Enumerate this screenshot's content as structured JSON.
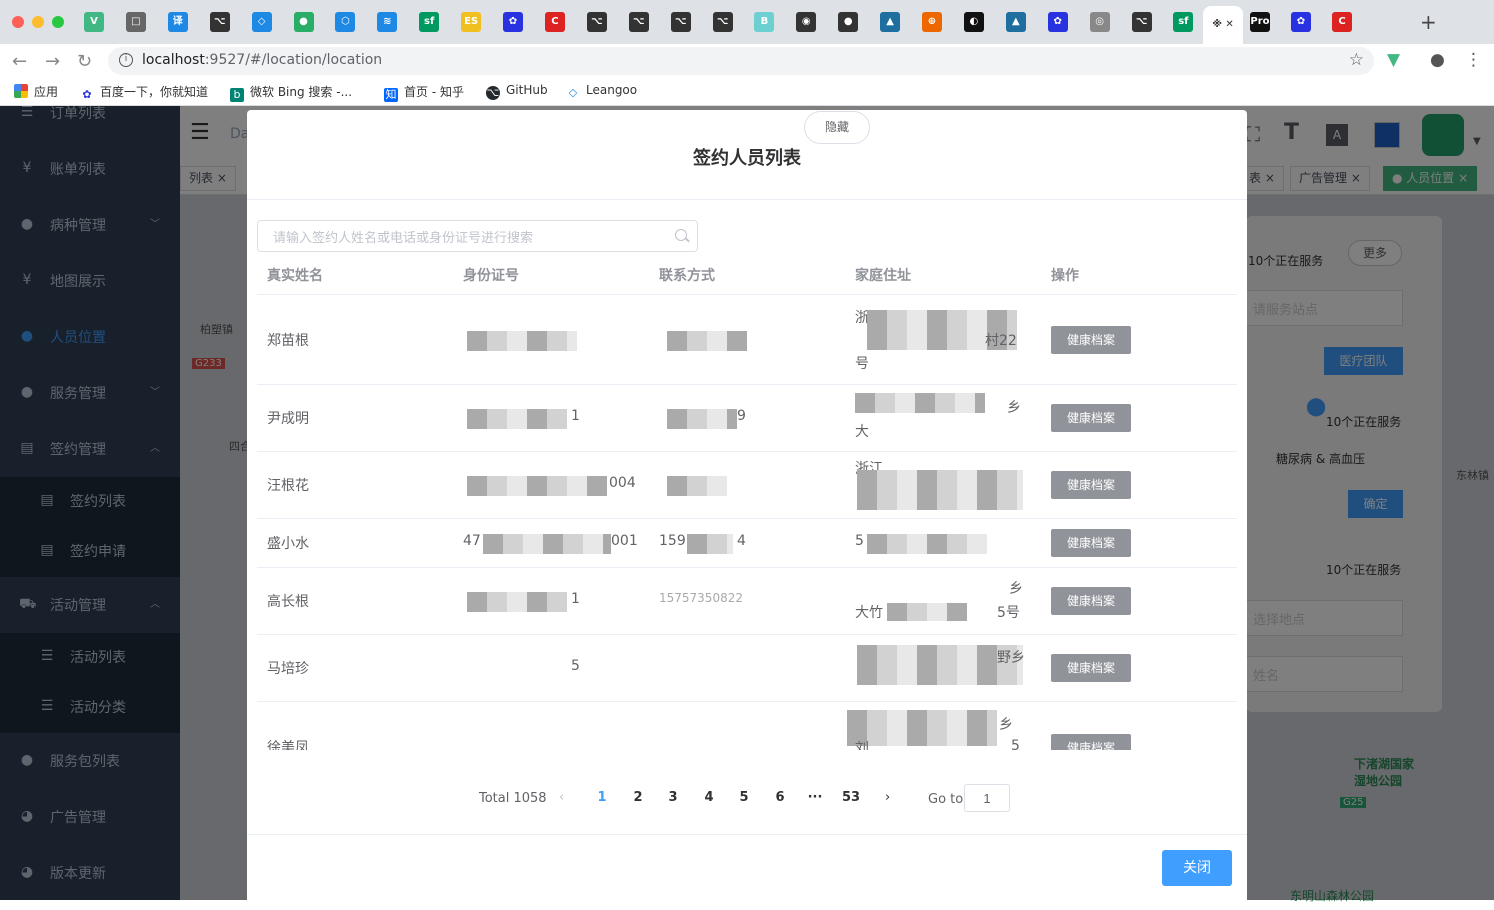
{
  "browser": {
    "url_host": "localhost",
    "url_rest": ":9527/#/location/location",
    "active_tab_label": "※",
    "tab_icons": [
      "V",
      "□",
      "译",
      "⌥",
      "◇",
      "●",
      "⬡",
      "≋",
      "sf",
      "ES",
      "✿",
      "C",
      "⌥",
      "⌥",
      "⌥",
      "⌥",
      "B",
      "◉",
      "●",
      "▲",
      "⊕",
      "◐",
      "▲",
      "✿",
      "◎",
      "⌥",
      "sf",
      "⬡",
      "Pro",
      "✿",
      "C"
    ]
  },
  "bookmarks": [
    {
      "label": "应用",
      "icon": "apps-grid-icon"
    },
    {
      "label": "百度一下，你就知道",
      "icon": "baidu-paw-icon"
    },
    {
      "label": "微软 Bing 搜索 -...",
      "icon": "bing-icon"
    },
    {
      "label": "首页 - 知乎",
      "icon": "zhihu-icon"
    },
    {
      "label": "GitHub",
      "icon": "github-icon"
    },
    {
      "label": "Leangoo",
      "icon": "leangoo-icon"
    }
  ],
  "sidebar": {
    "items": [
      {
        "label": "订单列表",
        "icon": "list-icon"
      },
      {
        "label": "账单列表",
        "icon": "yen-icon"
      },
      {
        "label": "病种管理",
        "icon": "user-icon"
      },
      {
        "label": "地图展示",
        "icon": "yen-icon"
      },
      {
        "label": "人员位置",
        "icon": "user-icon"
      },
      {
        "label": "服务管理",
        "icon": "user-icon"
      },
      {
        "label": "签约管理",
        "icon": "document-icon"
      },
      {
        "label": "签约列表",
        "icon": "document-icon"
      },
      {
        "label": "签约申请",
        "icon": "document-icon"
      },
      {
        "label": "活动管理",
        "icon": "cart-icon"
      },
      {
        "label": "活动列表",
        "icon": "list-icon"
      },
      {
        "label": "活动分类",
        "icon": "list-icon"
      },
      {
        "label": "服务包列表",
        "icon": "user-icon"
      },
      {
        "label": "广告管理",
        "icon": "globe-icon"
      },
      {
        "label": "版本更新",
        "icon": "globe-icon"
      }
    ]
  },
  "header": {
    "breadcrumb": "Da"
  },
  "tags": [
    {
      "label": "列表"
    },
    {
      "label": "表"
    },
    {
      "label": "广告管理"
    },
    {
      "label": "人员位置"
    }
  ],
  "map": {
    "labels": [
      "柏塑镇",
      "G233",
      "四合",
      "东林镇",
      "下渚湖国家湿地公园",
      "G25",
      "东明山森林公园"
    ]
  },
  "right_panel": {
    "status_top": "10个正在服务",
    "more": "更多",
    "station_placeholder": "请服务站点",
    "team_button": "医疗团队",
    "status_1": "10个正在服务",
    "disease": "糖尿病 & 高血压",
    "confirm": "确定",
    "status_2": "10个正在服务",
    "location_placeholder": "选择地点",
    "name_placeholder": "姓名"
  },
  "dialog": {
    "title": "签约人员列表",
    "hide_label": "隐藏",
    "search_placeholder": "请输入签约人姓名或电话或身份证号进行搜索",
    "columns": [
      "真实姓名",
      "身份证号",
      "联系方式",
      "家庭住址",
      "操作"
    ],
    "rows": [
      {
        "name": "郑苗根",
        "id_hint": "",
        "phone_hint": "",
        "addr1": "浙",
        "addr2": "村22",
        "addr3": "号"
      },
      {
        "name": "尹成明",
        "id_hint": "1",
        "phone_hint": "9",
        "addr1": "乡",
        "addr2": "大",
        "addr3": ""
      },
      {
        "name": "汪根花",
        "id_hint": "004",
        "phone_hint": "",
        "addr1": "浙江",
        "addr2": "",
        "addr3": ""
      },
      {
        "name": "盛小水",
        "id_hint": "47",
        "id_hint2": "001",
        "phone_hint": "159",
        "phone_hint2": "4",
        "addr1": "5",
        "addr2": "",
        "addr3": ""
      },
      {
        "name": "高长根",
        "id_hint": "1",
        "phone_hint": "15757350822",
        "addr1": "乡",
        "addr2": "大竹",
        "addr3": "5号"
      },
      {
        "name": "马培珍",
        "id_hint": "5",
        "phone_hint": "",
        "addr1": "野乡",
        "addr2": "",
        "addr3": ""
      },
      {
        "name": "徐美凤",
        "id_hint": "",
        "phone_hint": "",
        "addr1": "乡",
        "addr2": "刘",
        "addr3": "5"
      }
    ],
    "action_label": "健康档案",
    "pagination": {
      "total": "Total 1058",
      "pages": [
        "1",
        "2",
        "3",
        "4",
        "5",
        "6",
        "···",
        "53"
      ],
      "current": "1",
      "goto_label": "Go to",
      "goto_value": "1"
    },
    "close_label": "关闭"
  }
}
